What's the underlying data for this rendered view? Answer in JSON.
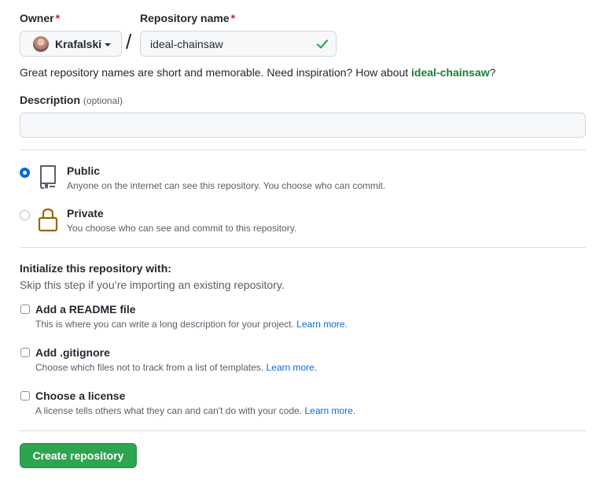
{
  "owner": {
    "label": "Owner",
    "required_mark": "*",
    "name": "Krafalski"
  },
  "repo": {
    "label": "Repository name",
    "required_mark": "*",
    "value": "ideal-chainsaw",
    "separator": "/"
  },
  "hint": {
    "text": "Great repository names are short and memorable. Need inspiration? How about ",
    "suggestion": "ideal-chainsaw",
    "suffix": "?"
  },
  "description": {
    "label": "Description",
    "optional": "(optional)",
    "value": ""
  },
  "visibility": {
    "selected": "public",
    "options": [
      {
        "title": "Public",
        "desc": "Anyone on the internet can see this repository. You choose who can commit."
      },
      {
        "title": "Private",
        "desc": "You choose who can see and commit to this repository."
      }
    ]
  },
  "init": {
    "title": "Initialize this repository with:",
    "subtitle": "Skip this step if you’re importing an existing repository.",
    "learn_more": "Learn more.",
    "items": [
      {
        "title": "Add a README file",
        "desc": "This is where you can write a long description for your project.",
        "checked": false
      },
      {
        "title": "Add .gitignore",
        "desc": "Choose which files not to track from a list of templates.",
        "checked": false
      },
      {
        "title": "Choose a license",
        "desc": "A license tells others what they can and can't do with your code.",
        "checked": false
      }
    ]
  },
  "submit": {
    "label": "Create repository"
  },
  "colors": {
    "accent_blue": "#0969da",
    "success_green": "#2da44e",
    "suggestion_green": "#1a7f37",
    "required_red": "#cf222e",
    "lock_gold": "#9a6700"
  }
}
